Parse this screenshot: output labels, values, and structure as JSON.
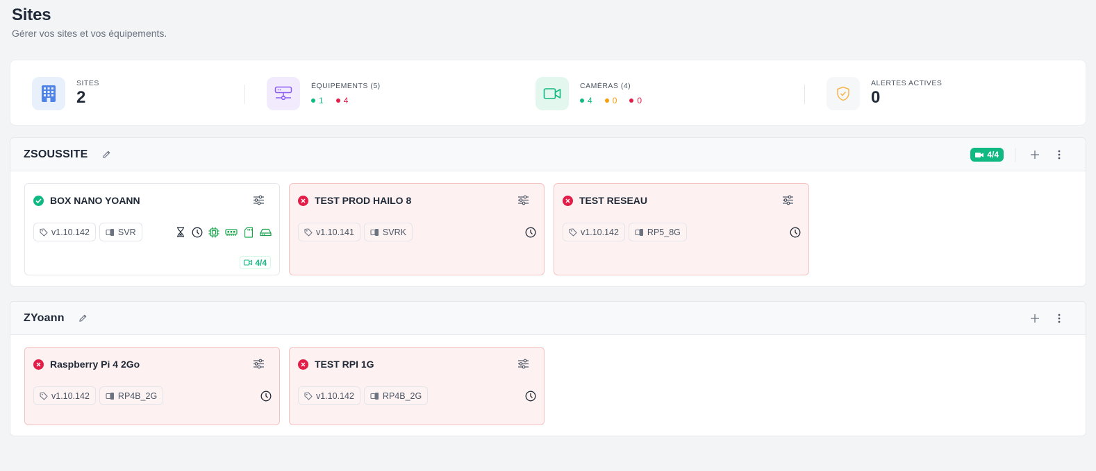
{
  "page": {
    "title": "Sites",
    "subtitle": "Gérer vos sites et vos équipements."
  },
  "stats": {
    "sites": {
      "label": "SITES",
      "value": "2"
    },
    "equipements": {
      "label": "ÉQUIPEMENTS (5)",
      "online": "1",
      "offline": "4"
    },
    "cameras": {
      "label": "CAMÉRAS (4)",
      "ok": "4",
      "warn": "0",
      "err": "0"
    },
    "alertes": {
      "label": "ALERTES ACTIVES",
      "value": "0"
    }
  },
  "colors": {
    "green": "#10b981",
    "red": "#e11d48",
    "orange": "#f59e0b",
    "purple": "#8b5cf6",
    "blue": "#3b82f6"
  },
  "sites": [
    {
      "name": "ZSOUSSITE",
      "cameras_badge": "4/4",
      "devices": [
        {
          "name": "BOX NANO YOANN",
          "status": "ok",
          "version": "v1.10.142",
          "model": "SVR",
          "cameras": "4/4"
        },
        {
          "name": "TEST PROD HAILO 8",
          "status": "error",
          "version": "v1.10.141",
          "model": "SVRK"
        },
        {
          "name": "TEST RESEAU",
          "status": "error",
          "version": "v1.10.142",
          "model": "RP5_8G"
        }
      ]
    },
    {
      "name": "ZYoann",
      "devices": [
        {
          "name": "Raspberry Pi 4 2Go",
          "status": "error",
          "version": "v1.10.142",
          "model": "RP4B_2G"
        },
        {
          "name": "TEST RPI 1G",
          "status": "error",
          "version": "v1.10.142",
          "model": "RP4B_2G"
        }
      ]
    }
  ],
  "icons": {
    "tag": "tag-icon",
    "model": "device-icon",
    "settings": "sliders-icon",
    "clock": "clock-icon",
    "hourglass": "hourglass-icon",
    "cpu": "cpu-icon",
    "ram": "memory-icon",
    "sd": "sd-card-icon",
    "disk": "hard-drive-icon",
    "edit": "pencil-icon",
    "add": "plus-icon",
    "more": "more-vertical-icon",
    "camera": "video-camera-icon"
  }
}
